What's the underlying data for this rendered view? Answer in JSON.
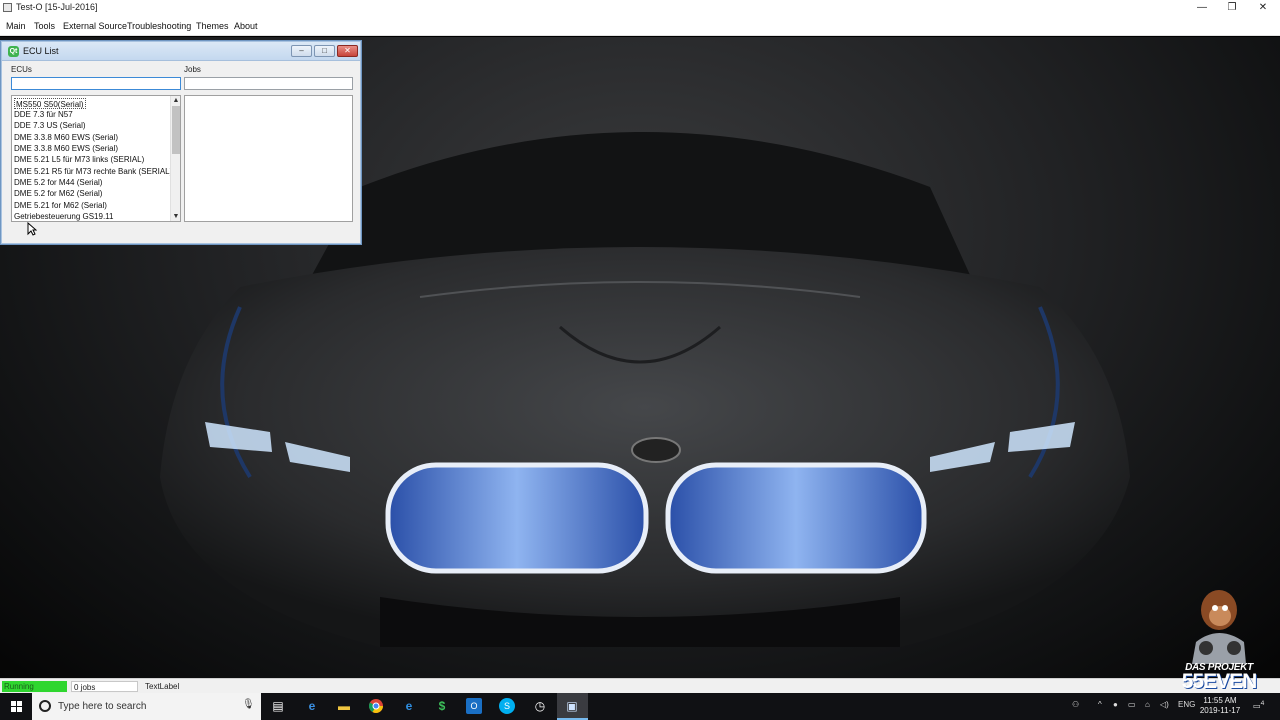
{
  "window": {
    "title": "Test-O [15-Jul-2016]",
    "controls": {
      "minimize": "—",
      "maximize": "❐",
      "close": "✕"
    }
  },
  "menu": [
    "Main",
    "Tools",
    "External Source",
    "Troubleshooting",
    "Themes",
    "About"
  ],
  "ecu_dialog": {
    "title": "ECU List",
    "ecus_label": "ECUs",
    "jobs_label": "Jobs",
    "ecu_filter_value": "",
    "jobs_filter_value": "",
    "ecu_items": [
      "MS550 S50(Serial)",
      "DDE 7.3 für N57",
      "DDE 7.3 US (Serial)",
      "DME 3.3.8 M60 EWS (Serial)",
      "DME 3.3.8 M60 EWS (Serial)",
      "DME 5.21 L5 für M73 links (SERIAL)",
      "DME 5.21 R5 für M73 rechte Bank (SERIAL)",
      "DME 5.2 for M44 (Serial)",
      "DME 5.2 for M62 (Serial)",
      "DME 5.21 for M62 (Serial)",
      "Getriebesteuerung GS19.11"
    ],
    "jobs_items": []
  },
  "statusbar": {
    "state": "Running",
    "jobs": "0 jobs",
    "text_label": "TextLabel",
    "state_color": "#2fd62f"
  },
  "taskbar": {
    "search_placeholder": "Type here to search",
    "apps": [
      "task-view",
      "edge",
      "file-explorer",
      "chrome",
      "internet-explorer",
      "app-s",
      "outlook",
      "skype",
      "app-clock",
      "test-o"
    ],
    "tray_language": "ENG",
    "clock_time": "11:55 AM",
    "clock_date": "2019-11-17",
    "notification_count": "4"
  },
  "watermark": {
    "line1": "DAS PROJEKT",
    "line2": "55EVEN"
  }
}
